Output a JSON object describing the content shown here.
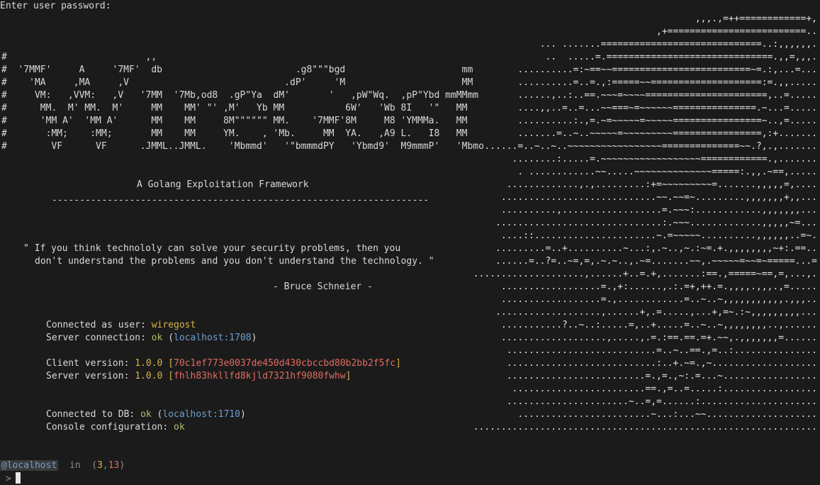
{
  "password_prompt": "Enter user password:",
  "banner_left": [
    "#                         ,,",
    "#  '7MMF'     A     '7MF'  db                        .g8\"\"\"bgd                     mm",
    "#    'MA     ,MA     ,V                            .dP'     'M                     MM",
    "#     VM:   ,VVM:   ,V   '7MM  '7Mb,od8  .gP\"Ya  dM'       '   ,pW\"Wq.  ,pP\"Ybd mmMMmm",
    "#      MM.  M' MM.  M'     MM    MM' \"' ,M'   Yb MM           6W'   'Wb 8I   '\"   MM",
    "#      'MM A'  'MM A'      MM    MM     8M\"\"\"\"\"\" MM.    '7MMF'8M     M8 'YMMMa.   MM",
    "#       :MM;    :MM;       MM    MM     YM.    , 'Mb.     MM  YA.   ,A9 L.   I8   MM",
    "#        VF      VF      .JMML..JMML.    'Mbmmd'   '\"bmmmdPY   'Ybmd9'  M9mmmP'   'Mbmo"
  ],
  "banner_right": [
    ",,,.,=++============+,",
    ",+=========================..",
    "... .......=============================..:,,,,,,.",
    "..  .....=.==============================.,,=,,,.",
    "..........=:~==~~=========================~=.:,...=...",
    "..........=..=.,:=====~~====================:=.,,.....",
    "......,..:..==.~~~=~~~~======================,..=.....",
    "....,,..=..=...~~===~=~~~~~~===============.~...=.....",
    "..........:.,=.~=~~~~~=~~~~~================~..,=.....",
    ".......=..~..~~~~~=~~~~~~~~~================,:+.......",
    "......=..~..~..~~~~~~~~~~~~~~~~~==============~~.?,.,.......",
    "........:.....=.~~~~~~~~~~~~~~~~~~============.,.......",
    ". ............~~.....~~~~~~~~~~~~~~=====:.,,.~==,.....",
    ".............,.,.........:+=~~~~~~~~~=.......,,,,,=,....",
    "............................~~.~~=~.........,,,,,,,+,,...",
    "..........,..................=.~~~:............,,,,,,,...",
    "..............................:.~~~.............,,,,,~=...",
    "....::......................~.=~~~~~..........,,,,,,..=~.",
    ".........=..+..........~...:,.~..,~.:~=.+.,,,,,,,,~+:.==..",
    "......=..?=..~=,=,.~.~..,.~=.......~~,.~~~~~=~~=~=====...=",
    "....................,......+..=.+,.......:==.,=====~==,=,...,.",
    "..................=.,+:......,.:.=+,++.=.,,,,.,,,.,=.....",
    "..................=.,............=..~..~,,,,,,,,,,,.,,,..",
    "...................,......+,.=.....,...+,=~.:~,,,,,,,,,...",
    "...........?..~..:.....=,..+.....=..~..~,,,,,,,,..,......",
    "...................,.....,.=.:==.==.=+.~~,.,,,,,,,=......",
    "...........................=..~..==.,=..:...............",
    "...........................:..+.~=.,~...................",
    ".........................=.,=.,~:.=...~.................",
    "........................==.,=..=.....:.................",
    "......................~..=,=......:.....................",
    "........................~...:...~~....................",
    ".............................................................."
  ],
  "tagline": "A Golang Exploitation Framework",
  "tagline_rule": "--------------------------------------------------------------------",
  "quote_line1": "\" If you think technololy can solve your security problems, then you",
  "quote_line2": "don't understand the problems and you don't understand the technology. \"",
  "quote_author": "- Bruce Schneier -",
  "status": {
    "connected_label": "Connected as user: ",
    "user": "wiregost",
    "server_conn_label": "Server connection: ",
    "server_conn_status": "ok",
    "server_conn_host": "localhost:1708",
    "client_version_label": "Client version: ",
    "client_version": "1.0.0",
    "client_hash": "70c1ef773e0037de450d430cbccbd80b2bb2f5fc",
    "server_version_label": "Server version: ",
    "server_version": "1.0.0",
    "server_hash": "fhlh83hkllfd8kjld7321hf9080fwhw",
    "db_label": "Connected to DB: ",
    "db_status": "ok",
    "db_host": "localhost:1710",
    "console_label": "Console configuration: ",
    "console_status": "ok"
  },
  "prompt": {
    "host": "@localhost",
    "in_word": "in",
    "coord_a": "3",
    "coord_b": "13",
    "caret": ">"
  },
  "colors": {
    "background": "#1b1b1b",
    "text": "#d9d9d9",
    "accent_yellow": "#d7b24a",
    "accent_blue": "#6f9fcf",
    "ok_green": "#b5bd68",
    "hash_red": "#e06c60"
  }
}
